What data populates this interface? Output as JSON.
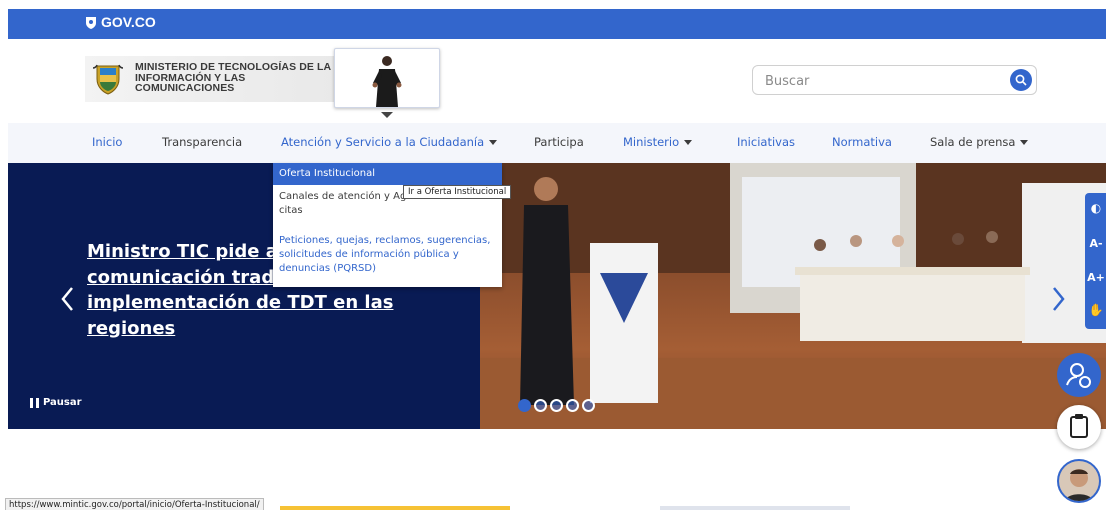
{
  "gov_bar": {
    "logo_text": "GOV.CO"
  },
  "header": {
    "ministry_name": "MINISTERIO DE TECNOLOGÍAS DE LA INFORMACIÓN Y LAS COMUNICACIONES",
    "search_placeholder": "Buscar"
  },
  "nav": {
    "items": [
      {
        "label": "Inicio"
      },
      {
        "label": "Transparencia"
      },
      {
        "label": "Atención y Servicio a la Ciudadanía"
      },
      {
        "label": "Participa"
      },
      {
        "label": "Ministerio"
      },
      {
        "label": "Iniciativas"
      },
      {
        "label": "Normativa"
      },
      {
        "label": "Sala de prensa"
      }
    ]
  },
  "dropdown": {
    "items": [
      {
        "label": "Oferta Institucional"
      },
      {
        "label": "Canales de atención y Agendamiento de citas"
      },
      {
        "label": "Peticiones, quejas, reclamos, sugerencias, solicitudes de información pública y denuncias (PQRSD)"
      }
    ],
    "tooltip": "Ir a Oferta Institucional"
  },
  "hero": {
    "headline": "Ministro TIC pide a comunicación tradicional y la implementación de TDT en las regiones",
    "pause_label": "Pausar",
    "slides_total": 5,
    "active_slide": 1
  },
  "accessibility": {
    "contrast": "◐",
    "font_decrease": "A-",
    "font_increase": "A+",
    "sign_language": "✋"
  },
  "status_bar": {
    "url": "https://www.mintic.gov.co/portal/inicio/Oferta-Institucional/"
  },
  "colors": {
    "gov_blue": "#3366cc",
    "hero_navy": "#091b54",
    "nav_bg": "#f4f6fb"
  }
}
